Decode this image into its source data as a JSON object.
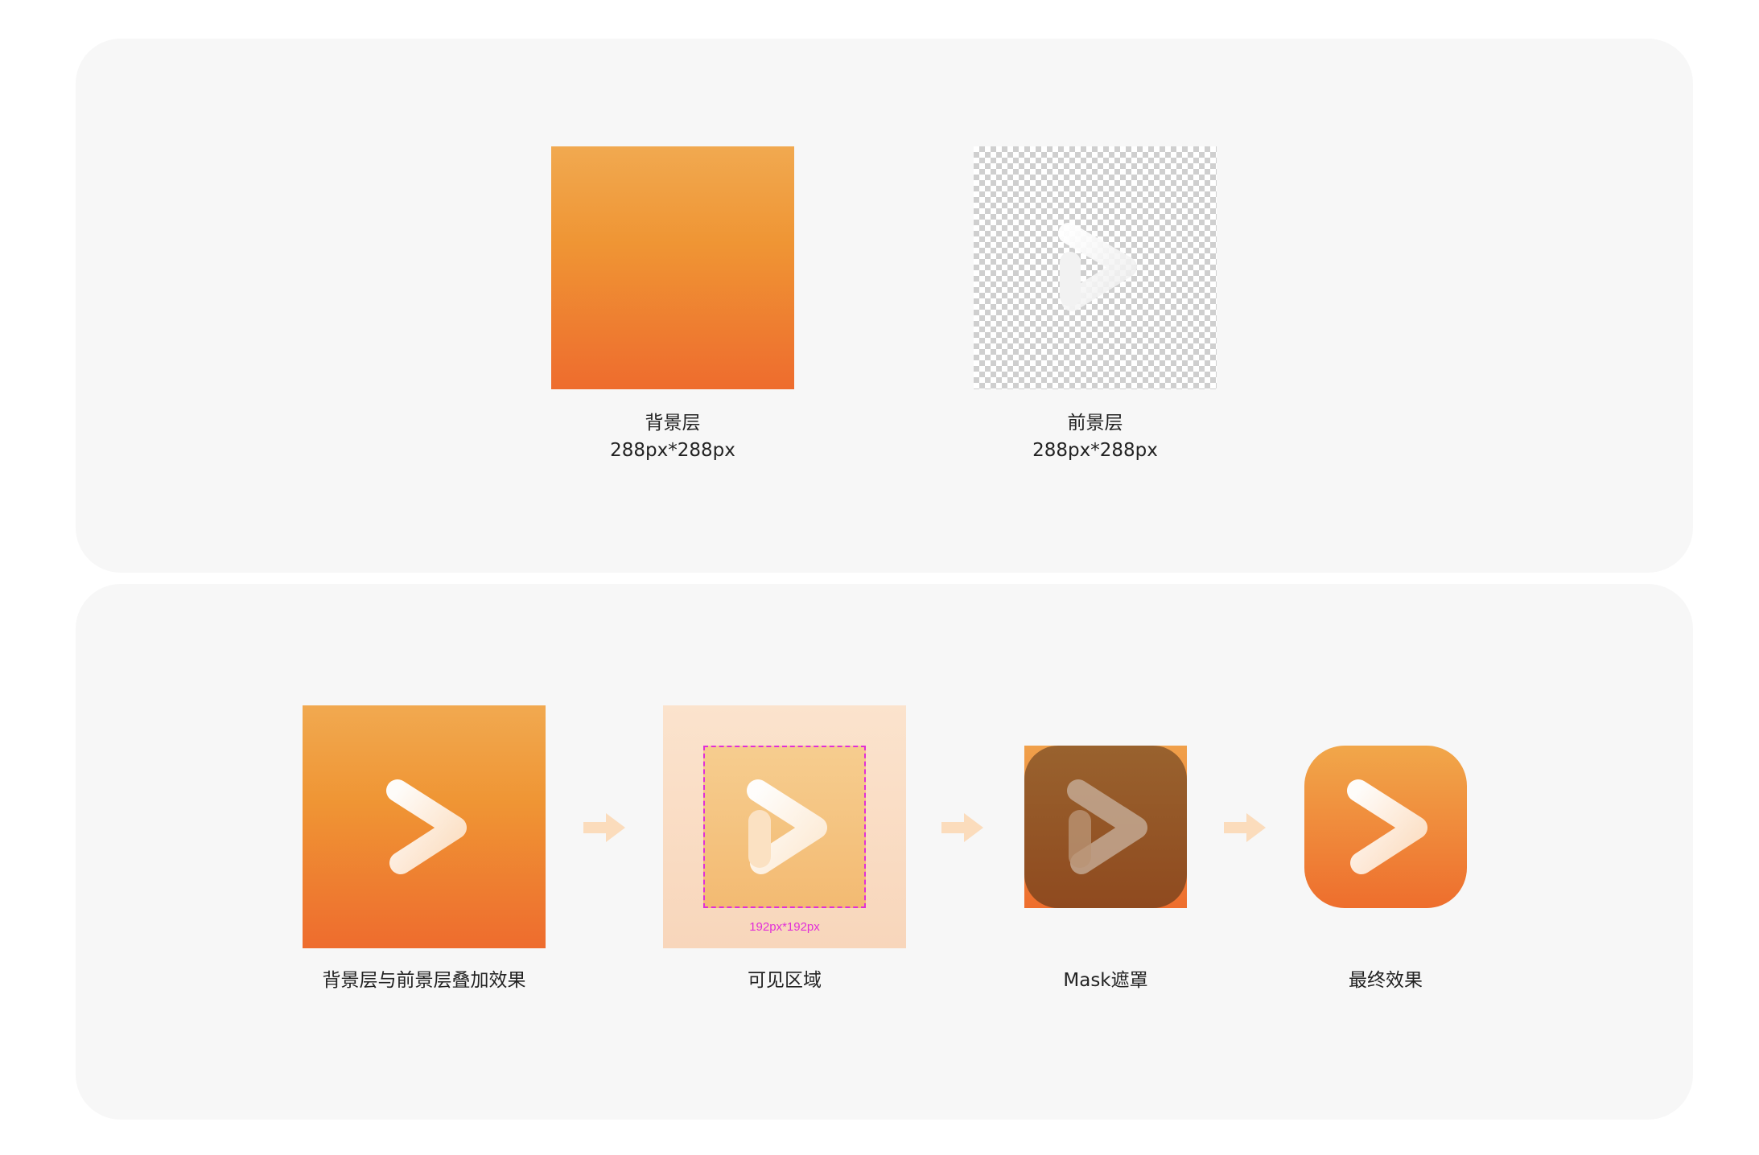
{
  "top_panel": {
    "background_layer": {
      "title": "背景层",
      "size": "288px*288px"
    },
    "foreground_layer": {
      "title": "前景层",
      "size": "288px*288px"
    }
  },
  "bottom_panel": {
    "steps": [
      {
        "caption": "背景层与前景层叠加效果"
      },
      {
        "caption": "可见区域",
        "dimension": "192px*192px"
      },
      {
        "caption": "Mask遮罩"
      },
      {
        "caption": "最终效果"
      }
    ]
  },
  "colors": {
    "panel_bg": "#f7f7f7",
    "gradient_top": "#f1a950",
    "gradient_bottom": "#ee6c2e",
    "dashed_outline": "#e12fd8",
    "arrow": "#fbdcbc"
  },
  "icons": [
    "play-triangle-icon",
    "arrow-right-icon"
  ]
}
